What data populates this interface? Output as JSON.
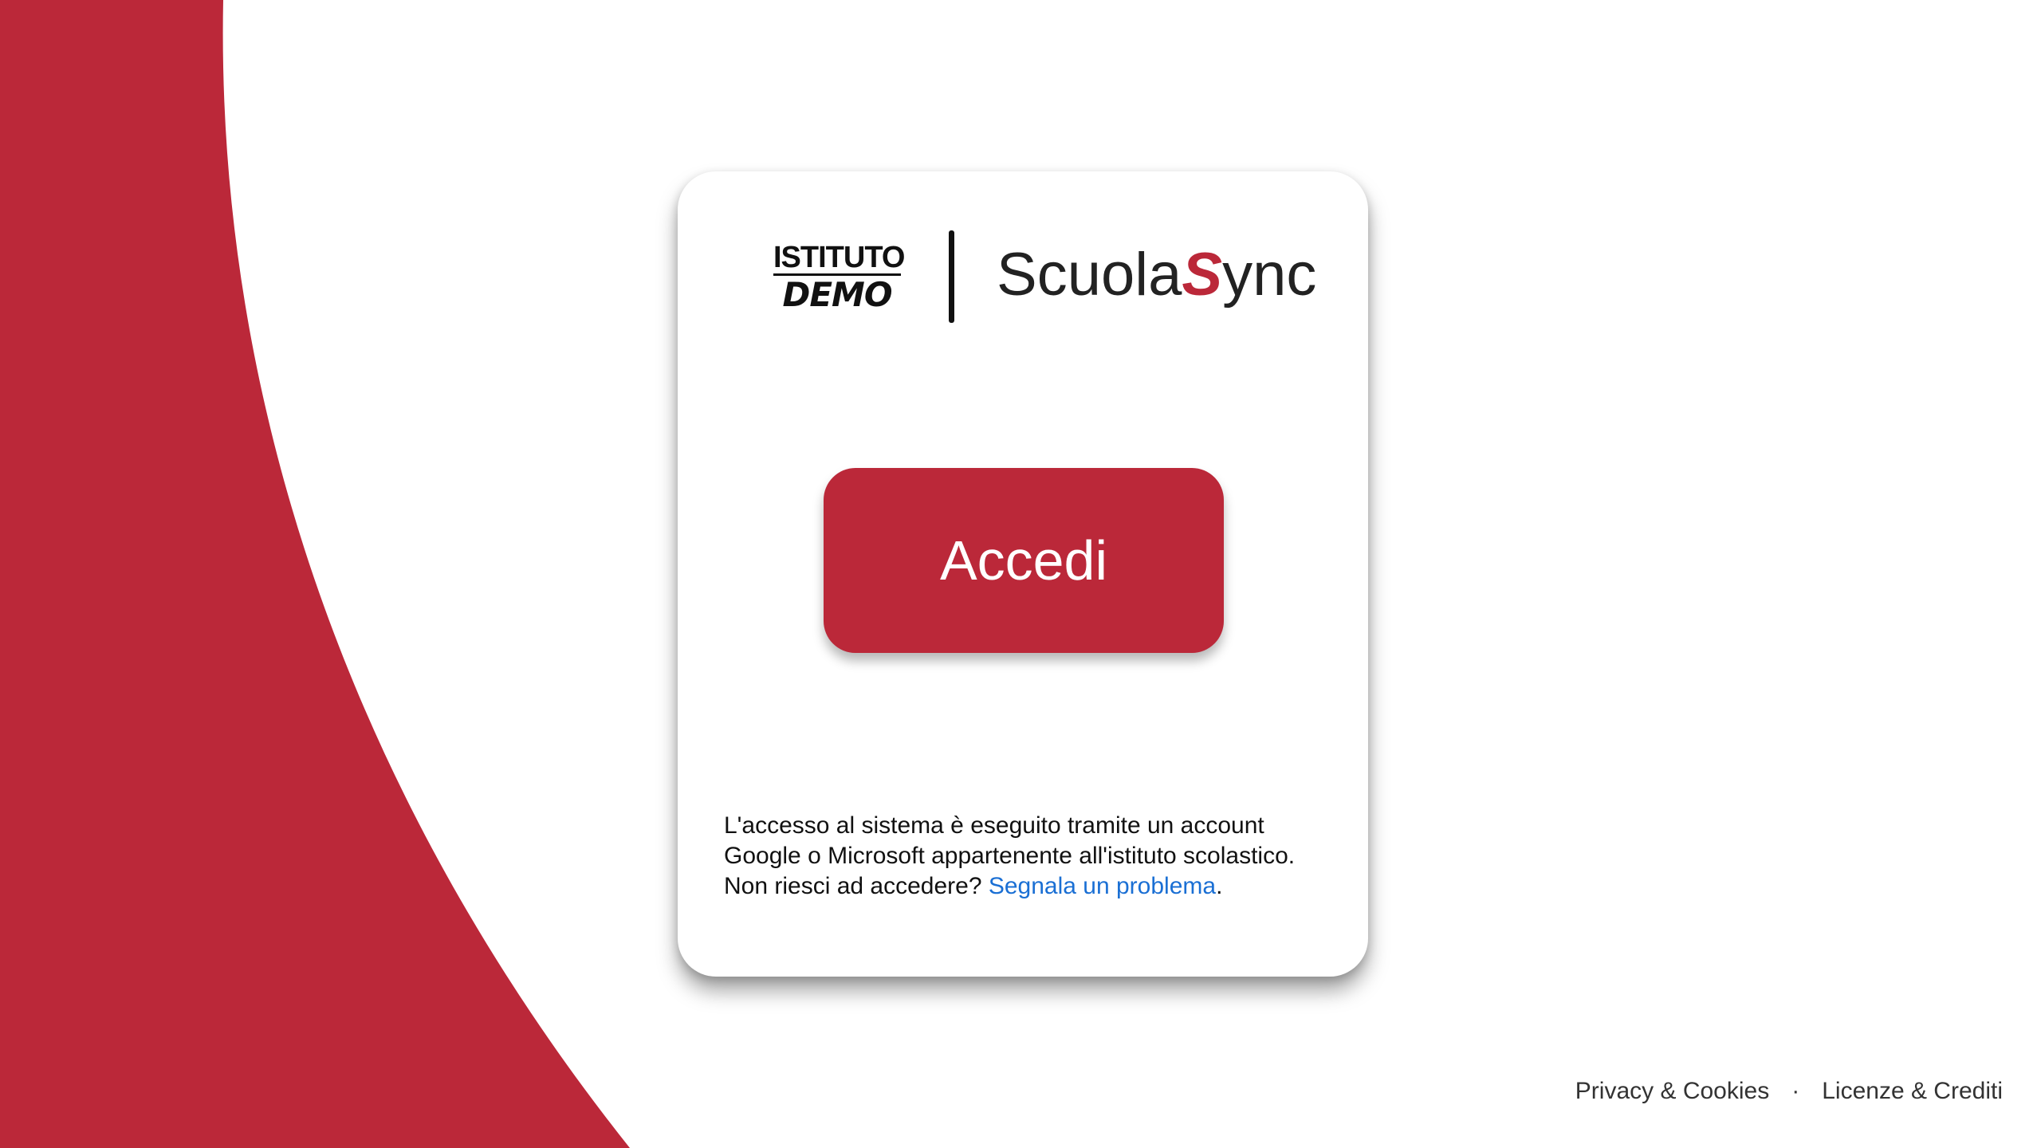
{
  "colors": {
    "accent": "#bb2839",
    "link": "#1a6fd4",
    "background": "#ffffff"
  },
  "logos": {
    "school_line1": "ISTITUTO",
    "school_line2": "DEMO",
    "brand_prefix": "Scuola",
    "brand_accent": "S",
    "brand_suffix": "ync"
  },
  "login": {
    "button_label": "Accedi"
  },
  "info": {
    "text": "L'accesso al sistema è eseguito tramite un account Google o Microsoft appartenente all'istituto scolastico.",
    "help_prefix": "Non riesci ad accedere? ",
    "help_link": "Segnala un problema",
    "help_suffix": "."
  },
  "footer": {
    "privacy_label": "Privacy & Cookies",
    "separator": "·",
    "licenses_label": "Licenze & Crediti"
  }
}
